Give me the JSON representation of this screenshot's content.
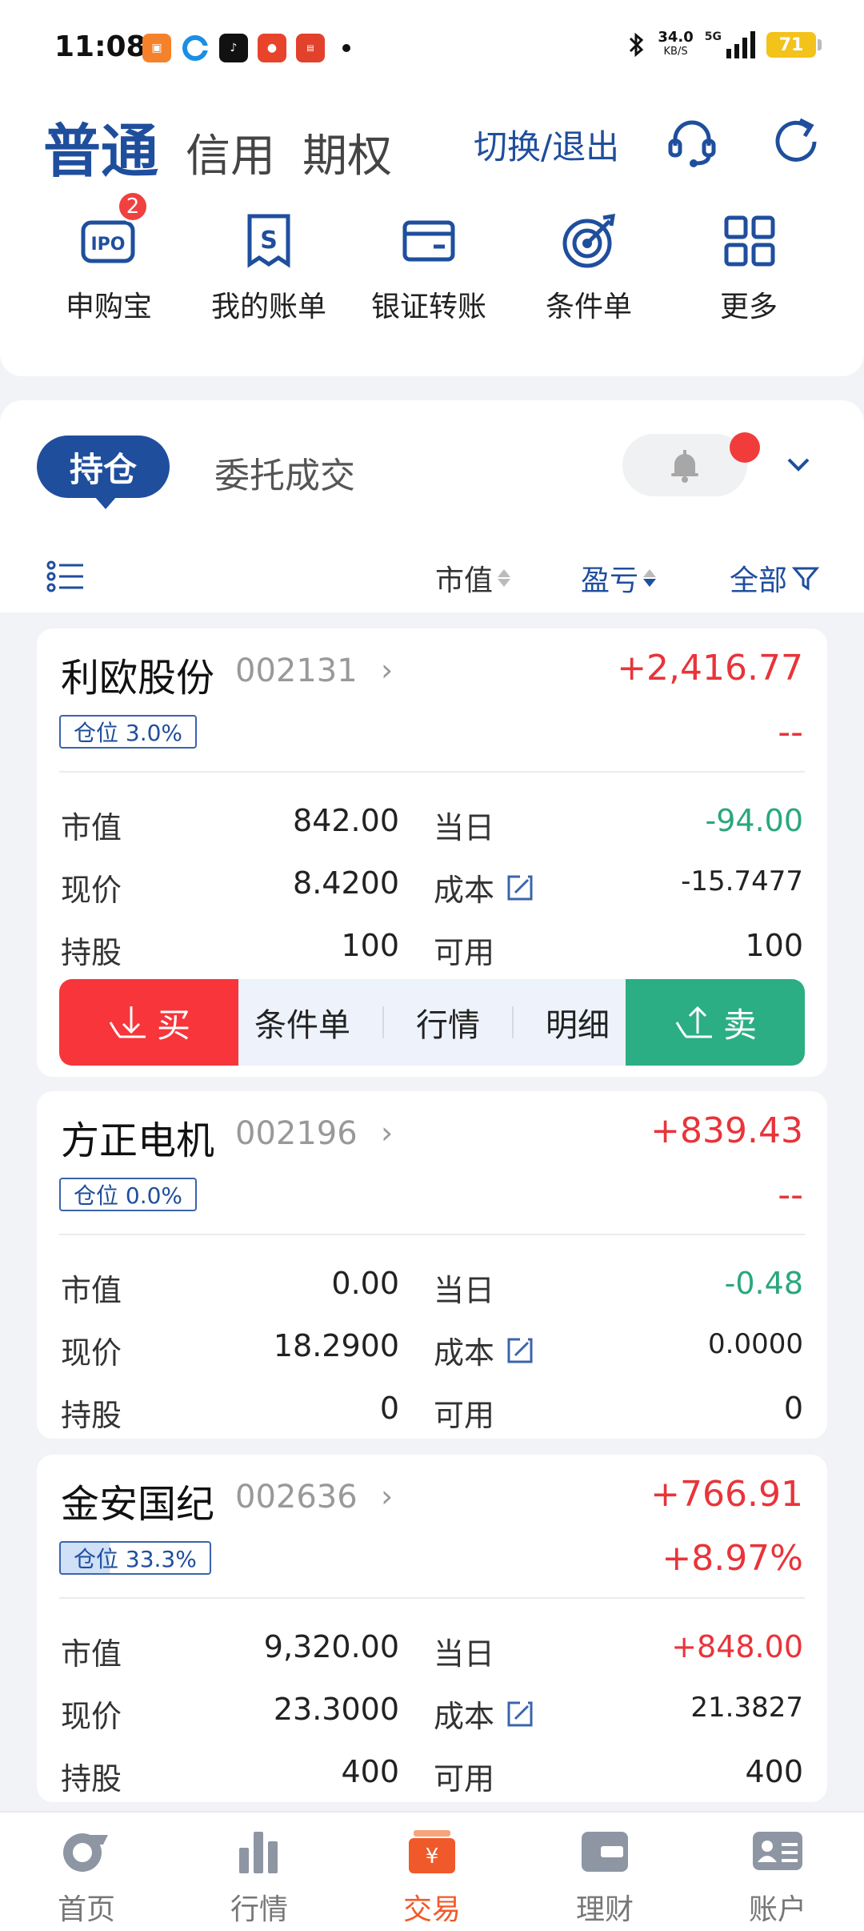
{
  "status": {
    "time": "11:08",
    "speed_value": "34.0",
    "speed_unit": "KB/S",
    "network": "5G",
    "battery": "71"
  },
  "header": {
    "tabs": [
      "普通",
      "信用",
      "期权"
    ],
    "switch_label": "切换/退出"
  },
  "quick": {
    "items": [
      {
        "label": "申购宝",
        "icon": "ipo-icon",
        "badge": "2"
      },
      {
        "label": "我的账单",
        "icon": "bill-icon"
      },
      {
        "label": "银证转账",
        "icon": "wallet-icon"
      },
      {
        "label": "条件单",
        "icon": "target-icon"
      },
      {
        "label": "更多",
        "icon": "grid-icon"
      }
    ]
  },
  "segment": {
    "active": "持仓",
    "other": "委托成交"
  },
  "sort": {
    "market_value": "市值",
    "profit": "盈亏",
    "filter": "全部"
  },
  "labels": {
    "market_value": "市值",
    "today": "当日",
    "price": "现价",
    "cost": "成本",
    "shares": "持股",
    "available": "可用"
  },
  "actions": {
    "buy": "买",
    "condition": "条件单",
    "quote": "行情",
    "detail": "明细",
    "sell": "卖"
  },
  "holdings": [
    {
      "name": "利欧股份",
      "code": "002131",
      "profit": "+2,416.77",
      "profit_pct": "--",
      "position": "仓位 3.0%",
      "market_value": "842.00",
      "today": "-94.00",
      "price": "8.4200",
      "cost": "-15.7477",
      "shares": "100",
      "available": "100"
    },
    {
      "name": "方正电机",
      "code": "002196",
      "profit": "+839.43",
      "profit_pct": "--",
      "position": "仓位 0.0%",
      "market_value": "0.00",
      "today": "-0.48",
      "price": "18.2900",
      "cost": "0.0000",
      "shares": "0",
      "available": "0"
    },
    {
      "name": "金安国纪",
      "code": "002636",
      "profit": "+766.91",
      "profit_pct": "+8.97%",
      "position": "仓位 33.3%",
      "position_fill": 0.333,
      "market_value": "9,320.00",
      "today": "+848.00",
      "price": "23.3000",
      "cost": "21.3827",
      "shares": "400",
      "available": "400"
    }
  ],
  "nav": {
    "items": [
      "首页",
      "行情",
      "交易",
      "理财",
      "账户"
    ],
    "active": "交易"
  },
  "colors": {
    "brand": "#1f4e9d",
    "up": "#e8343a",
    "down": "#2aa77e",
    "nav_active": "#f05a2a"
  }
}
